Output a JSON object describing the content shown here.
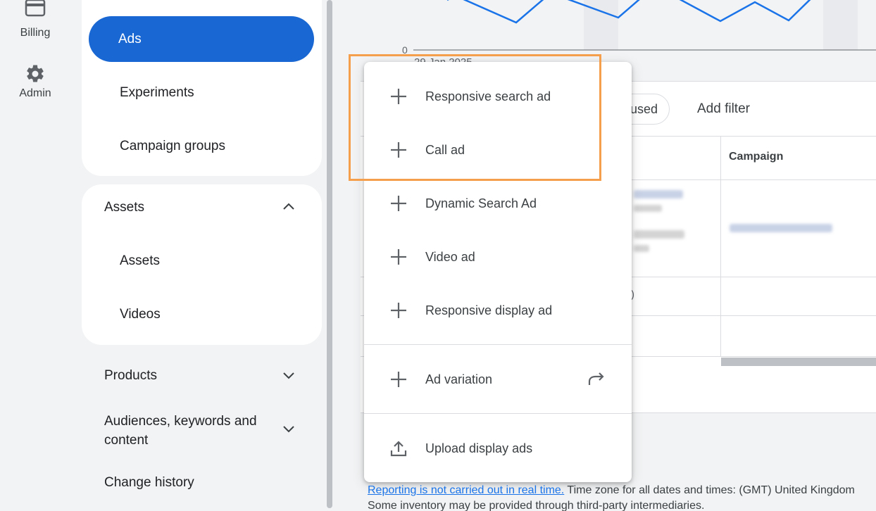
{
  "rail": {
    "billing_label": "Billing",
    "admin_label": "Admin"
  },
  "nav": {
    "active_item": "Ads",
    "items_top": [
      "Experiments",
      "Campaign groups"
    ],
    "assets_heading": "Assets",
    "assets_items": [
      "Assets",
      "Videos"
    ],
    "products_heading": "Products",
    "audiences_heading_line1": "Audiences, keywords and",
    "audiences_heading_line2": "content",
    "change_history": "Change history"
  },
  "chart": {
    "zero_label": "0",
    "date_label": "29 Jan 2025",
    "line_color": "#1a73e8"
  },
  "table": {
    "filter_chip_fragment": "used",
    "add_filter_label": "Add filter",
    "campaign_column": "Campaign",
    "row_fragment": ")"
  },
  "menu": {
    "items": [
      {
        "label": "Responsive search ad",
        "icon": "plus-icon"
      },
      {
        "label": "Call ad",
        "icon": "plus-icon"
      },
      {
        "label": "Dynamic Search Ad",
        "icon": "plus-icon"
      },
      {
        "label": "Video ad",
        "icon": "plus-icon"
      },
      {
        "label": "Responsive display ad",
        "icon": "plus-icon"
      }
    ],
    "ad_variation_label": "Ad variation",
    "upload_label": "Upload display ads"
  },
  "footer": {
    "link_text": "Reporting is not carried out in real time.",
    "timezone_text": " Time zone for all dates and times: (GMT) United Kingdom",
    "inventory_text": "Some inventory may be provided through third-party intermediaries."
  },
  "colors": {
    "accent": "#1967d2",
    "highlight": "#f59e4c"
  }
}
